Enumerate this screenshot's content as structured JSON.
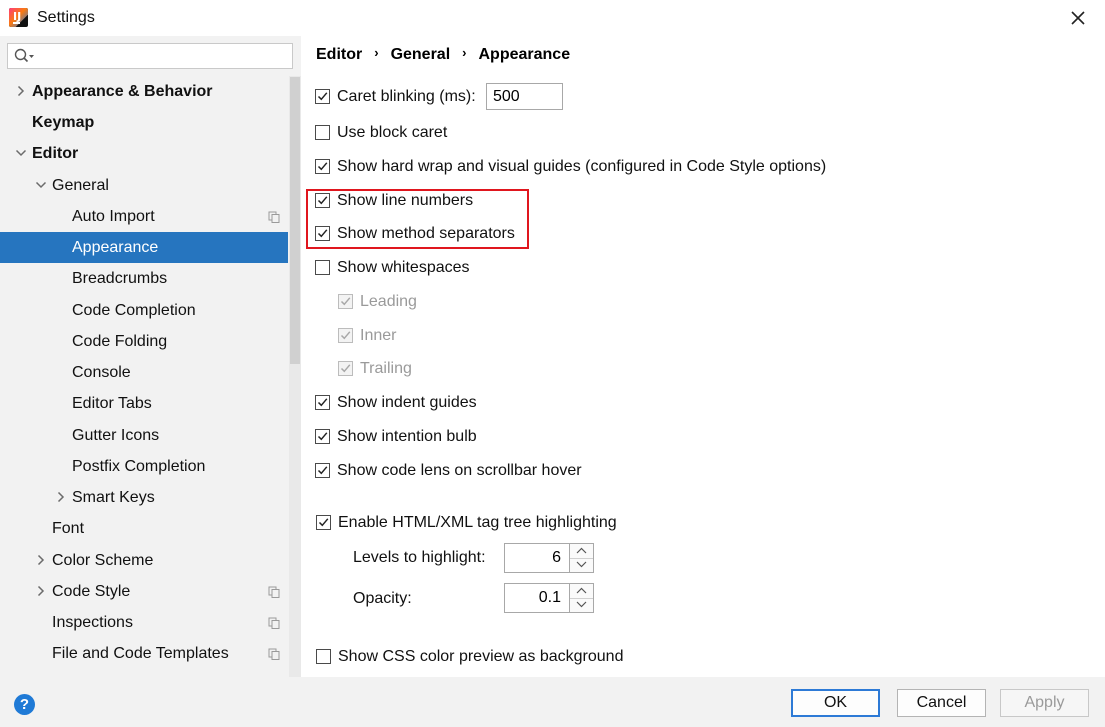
{
  "window": {
    "title": "Settings",
    "logo_text": "IJ"
  },
  "search": {
    "placeholder": "",
    "value": ""
  },
  "sidebar": {
    "items": [
      {
        "label": "Appearance & Behavior",
        "expandable": true,
        "expanded": false,
        "bold": true
      },
      {
        "label": "Keymap",
        "bold": true
      },
      {
        "label": "Editor",
        "expandable": true,
        "expanded": true,
        "bold": true
      },
      {
        "label": "General",
        "expandable": true,
        "expanded": true
      },
      {
        "label": "Auto Import",
        "has_copy_icon": true
      },
      {
        "label": "Appearance",
        "selected": true
      },
      {
        "label": "Breadcrumbs"
      },
      {
        "label": "Code Completion"
      },
      {
        "label": "Code Folding"
      },
      {
        "label": "Console"
      },
      {
        "label": "Editor Tabs"
      },
      {
        "label": "Gutter Icons"
      },
      {
        "label": "Postfix Completion"
      },
      {
        "label": "Smart Keys",
        "expandable": true,
        "expanded": false
      },
      {
        "label": "Font"
      },
      {
        "label": "Color Scheme",
        "expandable": true,
        "expanded": false
      },
      {
        "label": "Code Style",
        "expandable": true,
        "expanded": false,
        "has_copy_icon": true
      },
      {
        "label": "Inspections",
        "has_copy_icon": true
      },
      {
        "label": "File and Code Templates",
        "has_copy_icon": true
      }
    ]
  },
  "breadcrumb": [
    "Editor",
    "General",
    "Appearance"
  ],
  "options": {
    "caret_blinking": {
      "label": "Caret blinking (ms):",
      "checked": true,
      "value": "500"
    },
    "use_block_caret": {
      "label": "Use block caret",
      "checked": false
    },
    "show_hard_wrap": {
      "label": "Show hard wrap and visual guides (configured in Code Style options)",
      "checked": true
    },
    "show_line_numbers": {
      "label": "Show line numbers",
      "checked": true
    },
    "show_method_separators": {
      "label": "Show method separators",
      "checked": true
    },
    "show_whitespaces": {
      "label": "Show whitespaces",
      "checked": false
    },
    "leading": {
      "label": "Leading",
      "checked": true,
      "enabled": false
    },
    "inner": {
      "label": "Inner",
      "checked": true,
      "enabled": false
    },
    "trailing": {
      "label": "Trailing",
      "checked": true,
      "enabled": false
    },
    "show_indent_guides": {
      "label": "Show indent guides",
      "checked": true
    },
    "show_intention_bulb": {
      "label": "Show intention bulb",
      "checked": true
    },
    "show_code_lens": {
      "label": "Show code lens on scrollbar hover",
      "checked": true
    },
    "enable_tag_tree": {
      "label": "Enable HTML/XML tag tree highlighting",
      "checked": true
    },
    "levels_to_highlight": {
      "label": "Levels to highlight:",
      "value": "6"
    },
    "opacity": {
      "label": "Opacity:",
      "value": "0.1"
    },
    "show_css_color": {
      "label": "Show CSS color preview as background",
      "checked": false
    }
  },
  "footer": {
    "help_label": "?",
    "ok_label": "OK",
    "cancel_label": "Cancel",
    "apply_label": "Apply",
    "apply_enabled": false
  },
  "colors": {
    "selection": "#2675bf",
    "highlight_box": "#e0161e",
    "default_button_border": "#2d7ad6"
  }
}
